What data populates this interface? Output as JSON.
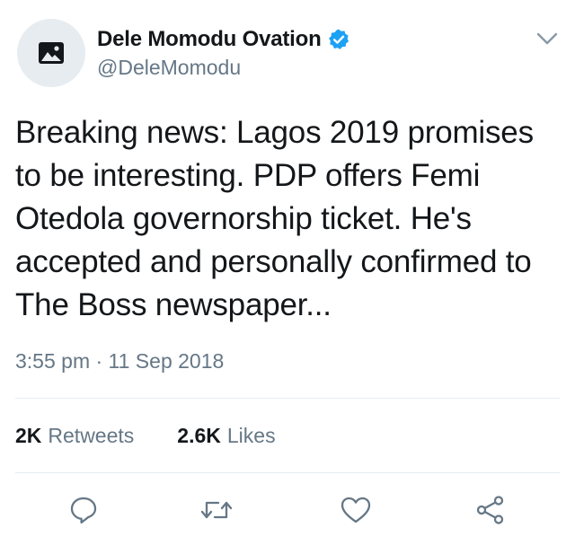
{
  "author": {
    "display_name": "Dele Momodu Ovation",
    "handle": "@DeleMomodu",
    "verified": true,
    "avatar_icon": "image-placeholder-icon"
  },
  "tweet": {
    "text": "Breaking news: Lagos 2019 promises to be interesting. PDP offers Femi Otedola governorship ticket. He's accepted and personally confirmed to The Boss newspaper...",
    "timestamp": "3:55 pm · 11 Sep 2018"
  },
  "stats": {
    "retweets_count": "2K",
    "retweets_label": "Retweets",
    "likes_count": "2.6K",
    "likes_label": "Likes"
  },
  "actions": [
    "reply-icon",
    "retweet-icon",
    "like-icon",
    "share-icon"
  ],
  "colors": {
    "text_primary": "#14171a",
    "text_secondary": "#657786",
    "verified_blue": "#1da1f2",
    "icon_gray": "#657786",
    "divider": "#e6ecf0",
    "avatar_bg": "#e6ecf0"
  }
}
